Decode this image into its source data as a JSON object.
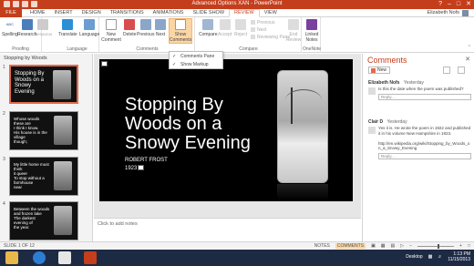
{
  "window": {
    "title": "Advanced Options XAN - PowerPoint",
    "controls": [
      "?",
      "–",
      "□",
      "✕"
    ]
  },
  "tabs": [
    "HOME",
    "INSERT",
    "DESIGN",
    "TRANSITIONS",
    "ANIMATIONS",
    "SLIDE SHOW",
    "REVIEW",
    "VIEW"
  ],
  "file_tab": "FILE",
  "active_tab": "REVIEW",
  "user": {
    "name": "Elizabeth Nofs"
  },
  "ribbon": {
    "proofing": {
      "label": "Proofing",
      "buttons": [
        "Spelling",
        "Research",
        "Thesaurus"
      ],
      "abc": "ABC"
    },
    "language": {
      "label": "Language",
      "buttons": [
        "Translate",
        "Language"
      ]
    },
    "comments": {
      "label": "Comments",
      "buttons": [
        "New Comment",
        "Delete",
        "Previous",
        "Next",
        "Show Comments"
      ]
    },
    "compare": {
      "label": "Compare",
      "buttons": [
        "Compare",
        "Accept",
        "Reject"
      ],
      "small": [
        "Previous",
        "Next",
        "Reviewing Pane"
      ],
      "end": "End Review"
    },
    "onenote": {
      "label": "OneNote",
      "button": "Linked Notes"
    }
  },
  "dropdown": {
    "items": [
      {
        "label": "Comments Pane",
        "checked": true
      },
      {
        "label": "Show Markup",
        "checked": true
      }
    ]
  },
  "thumbnails": {
    "section": "Stopping by Woods",
    "slides": [
      {
        "num": "1",
        "text": "Stopping By\nWoods on a\nSnowy Evening"
      },
      {
        "num": "2",
        "text": "Whose woods these are\nI think I know.\nHis house is in the village\nthough;"
      },
      {
        "num": "3",
        "text": "My little horse must think\nit queer\nTo stop without a farmhouse\nnear"
      },
      {
        "num": "4",
        "text": "Between the woods\nand frozen lake\nThe darkest evening of\nthe year."
      }
    ]
  },
  "slide": {
    "title": "Stopping By\nWoods on a\nSnowy Evening",
    "subtitle": "ROBERT FROST",
    "year": "1923"
  },
  "notes_placeholder": "Click to add notes",
  "comments_pane": {
    "title": "Comments",
    "new_label": "New",
    "comments": [
      {
        "author": "Elizabeth Nofs",
        "date": "Yesterday",
        "text": "Is this the date when the poem was published?",
        "reply": "Reply..."
      },
      {
        "author": "Clair D",
        "date": "Yesterday",
        "text": "Yes it is. He wrote the poem in 1922 and published it in his volume New Hampshire in 1923.\n\nhttp://en.wikipedia.org/wiki/Stopping_by_Woods_on_a_Snowy_Evening",
        "reply": "Reply..."
      }
    ]
  },
  "status": {
    "slide_info": "SLIDE 1 OF 12",
    "notes": "NOTES",
    "comments": "COMMENTS"
  },
  "taskbar": {
    "desktop": "Desktop",
    "time": "1:13 PM",
    "date": "11/15/2013"
  }
}
